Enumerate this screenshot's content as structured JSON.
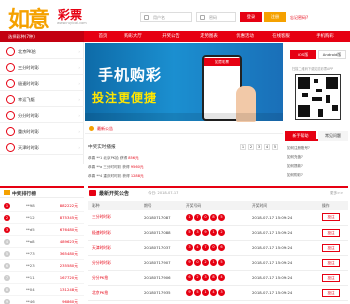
{
  "header": {
    "logo_main": "如意",
    "logo_sub": "彩票",
    "logo_url": "www.ruyicai.com",
    "username_placeholder": "用户名",
    "password_placeholder": "密码",
    "login_label": "登录",
    "register_label": "注册",
    "forgot_label": "忘记密码?"
  },
  "nav": {
    "category_label": "选择彩种(7种)",
    "items": [
      "首页",
      "购彩大厅",
      "开奖公告",
      "走势图表",
      "优惠活动",
      "在线客服",
      "手机购彩"
    ]
  },
  "left_menu": {
    "items": [
      "北京PK拾",
      "三分时时彩",
      "极速时时彩",
      "幸运飞艇",
      "分分时时彩",
      "重庆时时彩",
      "天津时时彩"
    ]
  },
  "banner": {
    "line1": "手机购彩",
    "line2": "投注更便捷",
    "phone_title": "如意彩票"
  },
  "notice": {
    "text": "最新公告"
  },
  "winners": {
    "title": "中奖实时播报",
    "pages": [
      "1",
      "2",
      "3",
      "4",
      "5"
    ],
    "rows": [
      [
        "恭喜",
        "**1",
        "北京PK拾",
        "获得",
        "856元"
      ],
      [
        "恭喜",
        "**a",
        "三分时时彩",
        "获得",
        "9560元"
      ],
      [
        "恭喜",
        "**4",
        "重庆时时彩",
        "获得",
        "1288元"
      ]
    ]
  },
  "right_panel": {
    "app_label": "iOS版",
    "android_label": "Android版",
    "qr_caption": "扫描二维码下载如意彩票APP",
    "tab_news": "新手帮助",
    "tab_tips": "常见问题",
    "news": [
      "如何注册账号?",
      "如何充值?",
      "如何提款?",
      "如何购彩?"
    ]
  },
  "ranking": {
    "title": "中奖排行榜",
    "rows": [
      {
        "no": "1",
        "name": "**98",
        "amount": "882222元"
      },
      {
        "no": "2",
        "name": "**12",
        "amount": "875345元"
      },
      {
        "no": "3",
        "name": "**d5",
        "amount": "676480元"
      },
      {
        "no": "4",
        "name": "**a8",
        "amount": "489623元"
      },
      {
        "no": "5",
        "name": "**73",
        "amount": "365480元"
      },
      {
        "no": "6",
        "name": "**23",
        "amount": "235580元"
      },
      {
        "no": "7",
        "name": "**11",
        "amount": "167720元"
      },
      {
        "no": "8",
        "name": "**04",
        "amount": "131248元"
      },
      {
        "no": "9",
        "name": "**46",
        "amount": "96860元"
      }
    ]
  },
  "draws": {
    "title": "最新开奖公告",
    "date_label": "今日: 2018-07-17",
    "more_label": "更多>>",
    "headers": [
      "彩种",
      "期号",
      "开奖号码",
      "开奖时间",
      "操作"
    ],
    "op_label": "投注",
    "rows": [
      {
        "name": "三分时时彩",
        "issue": "20180717087",
        "balls": [
          "1",
          "7",
          "0",
          "8",
          "5"
        ],
        "time": "2018-07-17 15:09:24"
      },
      {
        "name": "极速时时彩",
        "issue": "20180717088",
        "balls": [
          "5",
          "3",
          "9",
          "1",
          "2"
        ],
        "time": "2018-07-17 15:09:24"
      },
      {
        "name": "天津时时彩",
        "issue": "20180717037",
        "balls": [
          "3",
          "4",
          "7",
          "0",
          "6"
        ],
        "time": "2018-07-17 15:09:24"
      },
      {
        "name": "分分时时彩",
        "issue": "20180717907",
        "balls": [
          "9",
          "0",
          "2",
          "1",
          "5"
        ],
        "time": "2018-07-17 15:09:24"
      },
      {
        "name": "分分PK拾",
        "issue": "20180717906",
        "balls": [
          "6",
          "2",
          "3",
          "8",
          "4"
        ],
        "time": "2018-07-17 15:09:24"
      },
      {
        "name": "北京PK拾",
        "issue": "20180717935",
        "balls": [
          "9",
          "5",
          "1",
          "4",
          "3"
        ],
        "time": "2018-07-17 15:09:24"
      },
      {
        "name": "幸运飞艇",
        "issue": "20180717154",
        "balls": [
          "2",
          "6",
          "8",
          "5",
          "1"
        ],
        "time": "2018-07-17 15:09:24"
      }
    ]
  }
}
